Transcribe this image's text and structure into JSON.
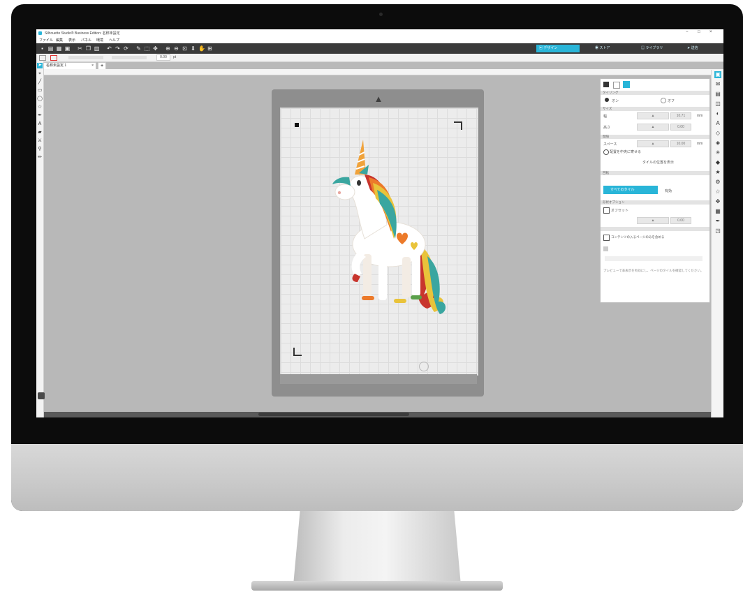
{
  "device": {
    "screen_background": "#b9b9b9",
    "accent_color": "#29b5d8"
  },
  "app": {
    "title": "Silhouette Studio® Business Edition: 名称未設定",
    "menus": [
      "ファイル",
      "編集",
      "表示",
      "パネル",
      "環境",
      "ヘルプ"
    ],
    "nav_tabs": [
      "デザイン",
      "ストア",
      "ライブラリ",
      "送信"
    ],
    "document_tab": "名称未設定 1",
    "options": {
      "zoom_value": "0.00",
      "unit": "pt"
    }
  },
  "panel": {
    "sections": {
      "size": "サイズ",
      "rotate": "回転",
      "tiling": "タイリング",
      "spacing": "間隔",
      "shape_opts": "形状オプション"
    },
    "labels": {
      "on": "オン",
      "off": "オフ",
      "width": "幅",
      "height": "高さ",
      "spacing": "スペース",
      "unit_mm": "mm",
      "enable": "有効",
      "shadow": "オフセット",
      "center_layout": "配置を中央に寄せる",
      "preview_btn": "タイルの位置を表示",
      "apply": "すべてのタイル"
    },
    "values": {
      "width": "10.71",
      "height": "0.00",
      "spacing": "10.00",
      "offset": "0.00"
    },
    "checkbox_label": "コンテンツの入るページのみを含める",
    "note": "プレビューで非表示を有効にし、ページのタイルを確認してください。"
  },
  "icons": {
    "left_tools": [
      "pointer-icon",
      "edit-points-icon",
      "line-icon",
      "rectangle-icon",
      "ellipse-icon",
      "polygon-icon",
      "freehand-icon",
      "text-icon",
      "eraser-icon",
      "knife-icon",
      "eyedropper-icon"
    ],
    "right_tools": [
      "page-setup-icon",
      "send-icon",
      "library-icon",
      "transform-icon",
      "fill-icon",
      "text-style-icon",
      "offset-icon",
      "trace-icon",
      "replicate-icon",
      "modify-icon",
      "align-icon",
      "scale-icon",
      "rotate-icon",
      "move-icon",
      "layers-icon"
    ]
  }
}
